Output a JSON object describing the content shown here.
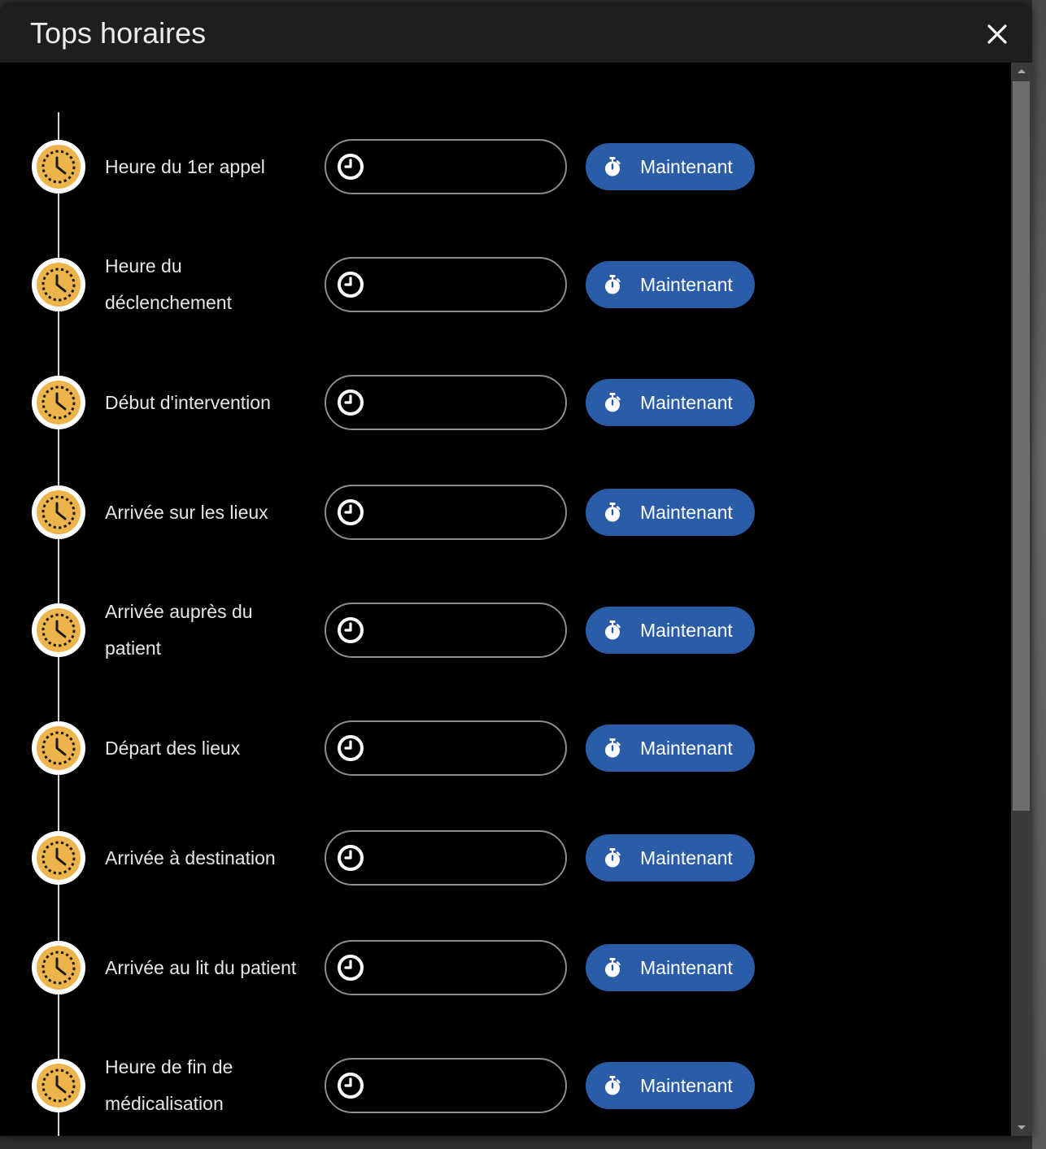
{
  "dialog": {
    "title": "Tops horaires"
  },
  "rows": [
    {
      "label": "Heure du 1er appel",
      "value": "",
      "button_label": "Maintenant"
    },
    {
      "label": "Heure du déclenchement",
      "value": "",
      "button_label": "Maintenant"
    },
    {
      "label": "Début d'intervention",
      "value": "",
      "button_label": "Maintenant"
    },
    {
      "label": "Arrivée sur les lieux",
      "value": "",
      "button_label": "Maintenant"
    },
    {
      "label": "Arrivée auprès du patient",
      "value": "",
      "button_label": "Maintenant"
    },
    {
      "label": "Départ des lieux",
      "value": "",
      "button_label": "Maintenant"
    },
    {
      "label": "Arrivée à destination",
      "value": "",
      "button_label": "Maintenant"
    },
    {
      "label": "Arrivée au lit du patient",
      "value": "",
      "button_label": "Maintenant"
    },
    {
      "label": "Heure de fin de médicalisation",
      "value": "",
      "button_label": "Maintenant"
    }
  ],
  "icons": {
    "close": "close-icon",
    "timeline_marker": "clock-icon",
    "time_field": "clock-icon",
    "now_button": "stopwatch-icon"
  },
  "colors": {
    "header_bg": "#1e1e1e",
    "body_bg": "#000000",
    "accent": "#2a5ca8",
    "marker": "#ecb44a"
  }
}
